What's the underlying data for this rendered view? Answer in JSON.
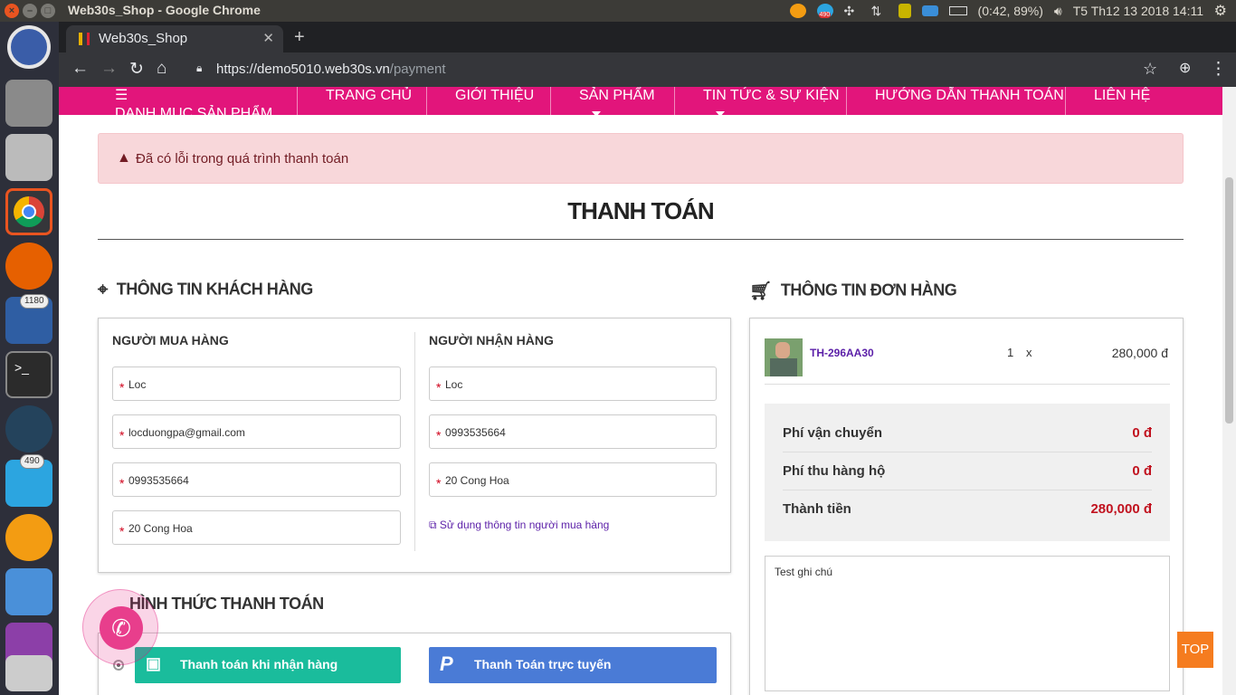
{
  "os": {
    "window_title": "Web30s_Shop - Google Chrome",
    "battery": "(0:42, 89%)",
    "clock": "T5 Th12 13 2018 14:11",
    "tray_badge": "490",
    "launcher_badges": [
      "1180",
      "490"
    ]
  },
  "browser": {
    "tab_title": "Web30s_Shop",
    "url_host": "https://demo5010.web30s.vn",
    "url_path": "/payment"
  },
  "nav": {
    "menu": "DANH MỤC SẢN PHẨM",
    "home": "TRANG CHỦ",
    "about": "GIỚI THIỆU",
    "products": "SẢN PHẨM",
    "news": "TIN TỨC & SỰ KIỆN",
    "guide": "HƯỚNG DẪN THANH TOÁN",
    "contact": "LIÊN HỆ"
  },
  "alert": "Đã có lỗi trong quá trình thanh toán",
  "page_title": "THANH TOÁN",
  "customer": {
    "heading": "THÔNG TIN KHÁCH HÀNG",
    "buyer": {
      "heading": "NGƯỜI MUA HÀNG",
      "name": "Loc",
      "email": "locduongpa@gmail.com",
      "phone": "0993535664",
      "address": "20 Cong Hoa"
    },
    "receiver": {
      "heading": "NGƯỜI NHẬN HÀNG",
      "name": "Loc",
      "phone": "0993535664",
      "address": "20 Cong Hoa"
    },
    "use_buyer_link": "Sử dụng thông tin người mua hàng"
  },
  "order": {
    "heading": "THÔNG TIN ĐƠN HÀNG",
    "item": {
      "code": "TH-296AA30",
      "qty": "1",
      "x": "x",
      "price": "280,000 đ"
    },
    "shipping_label": "Phí vận chuyển",
    "shipping_value": "0 đ",
    "cod_label": "Phí thu hàng hộ",
    "cod_value": "0 đ",
    "total_label": "Thành tiền",
    "total_value": "280,000 đ",
    "note": "Test ghi chú"
  },
  "payment": {
    "heading": "HÌNH THỨC THANH TOÁN",
    "cod": "Thanh toán khi nhận hàng",
    "online": "Thanh Toán trực tuyến"
  },
  "top_button": "TOP",
  "colors": {
    "brand": "#e2157b",
    "cod_green": "#1abc9c",
    "online_blue": "#4a7bd6",
    "top_orange": "#f57c1f"
  }
}
